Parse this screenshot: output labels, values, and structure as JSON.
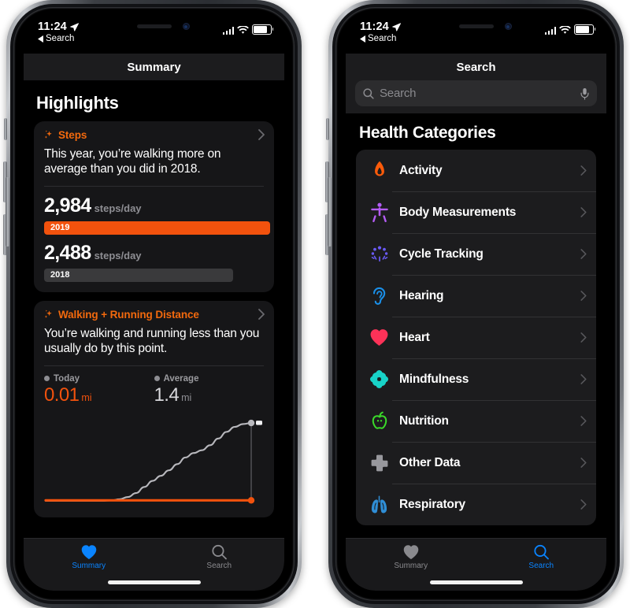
{
  "devices": [
    {
      "id": "left-phone",
      "status": {
        "time": "11:24",
        "back_label": "Search",
        "location_icon": "location-arrow-icon",
        "signal_icon": "cellular-signal-icon",
        "wifi_icon": "wifi-icon",
        "battery_icon": "battery-icon"
      },
      "nav": {
        "title": "Summary"
      },
      "page_heading": "Highlights",
      "cards": [
        {
          "icon": "sparkle-icon",
          "title": "Steps",
          "sentence": "This year, you’re walking more on average than you did in 2018.",
          "chevron": "chevron-right-icon",
          "metrics": [
            {
              "value": "2,984",
              "unit": "steps/day",
              "bar_label": "2019",
              "bar_color": "#f2520d",
              "bar_fill_pct": 100
            },
            {
              "value": "2,488",
              "unit": "steps/day",
              "bar_label": "2018",
              "bar_color": "#3a3a3c",
              "bar_fill_pct": 83
            }
          ]
        },
        {
          "icon": "sparkle-icon",
          "title": "Walking + Running Distance",
          "sentence": "You’re walking and running less than you usually do by this point.",
          "chevron": "chevron-right-icon",
          "legend": [
            {
              "label": "Today",
              "value": "0.01",
              "unit": "mi",
              "color": "#f2520d"
            },
            {
              "label": "Average",
              "value": "1.4",
              "unit": "mi",
              "color": "#d8d8dc"
            }
          ]
        }
      ],
      "tabs": [
        {
          "label": "Summary",
          "icon": "heart-icon",
          "active": true
        },
        {
          "label": "Search",
          "icon": "magnifier-icon",
          "active": false
        }
      ]
    },
    {
      "id": "right-phone",
      "status": {
        "time": "11:24",
        "back_label": "Search",
        "location_icon": "location-arrow-icon",
        "signal_icon": "cellular-signal-icon",
        "wifi_icon": "wifi-icon",
        "battery_icon": "battery-icon"
      },
      "nav": {
        "title": "Search"
      },
      "search": {
        "placeholder": "Search",
        "value": "",
        "search_icon": "search-icon",
        "mic_icon": "microphone-icon"
      },
      "section_title": "Health Categories",
      "categories": [
        {
          "label": "Activity",
          "icon": "flame-icon",
          "color": "#fb5b0a"
        },
        {
          "label": "Body Measurements",
          "icon": "body-icon",
          "color": "#b45cf5"
        },
        {
          "label": "Cycle Tracking",
          "icon": "cycle-icon",
          "color": "#6a5af7"
        },
        {
          "label": "Hearing",
          "icon": "ear-icon",
          "color": "#1a8fe8"
        },
        {
          "label": "Heart",
          "icon": "heart-icon",
          "color": "#fc3258"
        },
        {
          "label": "Mindfulness",
          "icon": "flower-icon",
          "color": "#18d3c8"
        },
        {
          "label": "Nutrition",
          "icon": "apple-icon",
          "color": "#3bdb2a"
        },
        {
          "label": "Other Data",
          "icon": "cross-icon",
          "color": "#98989d"
        },
        {
          "label": "Respiratory",
          "icon": "lungs-icon",
          "color": "#2f8ed6"
        }
      ],
      "tabs": [
        {
          "label": "Summary",
          "icon": "heart-icon",
          "active": false
        },
        {
          "label": "Search",
          "icon": "magnifier-icon",
          "active": true
        }
      ]
    }
  ],
  "chart_data": {
    "type": "line",
    "title": "Walking + Running Distance",
    "xlabel": "",
    "ylabel": "mi",
    "ylim": [
      0,
      1.5
    ],
    "series": [
      {
        "name": "Average",
        "color": "#b8b8bd",
        "x": [
          0,
          4,
          8,
          12,
          16,
          20,
          24,
          28,
          32,
          36,
          40,
          44,
          48,
          52,
          56,
          60,
          64,
          68,
          72,
          76,
          80,
          84,
          88,
          92,
          96,
          100
        ],
        "values": [
          0.0,
          0.0,
          0.0,
          0.0,
          0.0,
          0.0,
          0.0,
          0.0,
          0.01,
          0.03,
          0.07,
          0.14,
          0.25,
          0.36,
          0.45,
          0.55,
          0.66,
          0.78,
          0.86,
          0.91,
          1.0,
          1.12,
          1.24,
          1.33,
          1.38,
          1.4
        ]
      },
      {
        "name": "Today",
        "color": "#f2520d",
        "x": [
          0,
          20,
          40,
          60,
          80,
          100
        ],
        "values": [
          0.01,
          0.01,
          0.01,
          0.01,
          0.01,
          0.01
        ]
      }
    ],
    "markers": [
      {
        "series": "Average",
        "x": 100,
        "y": 1.4,
        "color": "#b8b8bd"
      },
      {
        "series": "Today",
        "x": 100,
        "y": 0.01,
        "color": "#f2520d"
      }
    ],
    "grid": false,
    "legend": "top"
  }
}
